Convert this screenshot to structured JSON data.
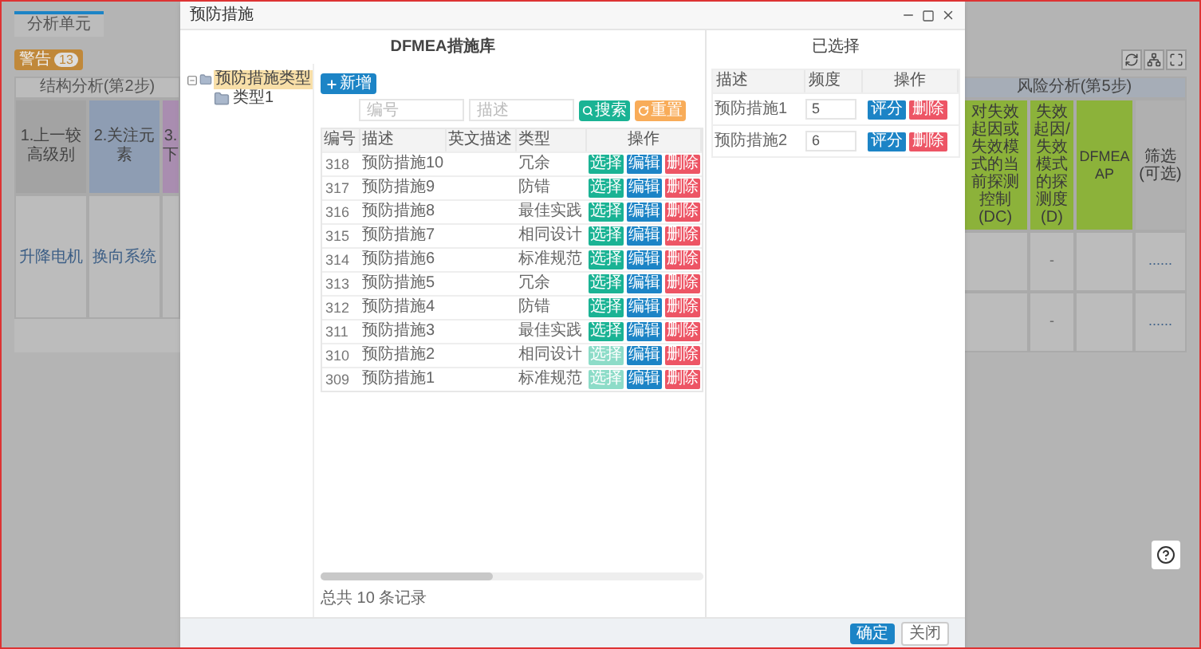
{
  "background": {
    "tabs": [
      {
        "label": "分析单元",
        "selected": true
      }
    ],
    "badge": {
      "label": "警告",
      "count": "13"
    },
    "left_table": {
      "group": "结构分析(第2步)",
      "columns": [
        {
          "label": "1.上一较高级别",
          "color": "#a3a3a3"
        },
        {
          "label": "2.关注元素",
          "color": "#8e9db3"
        },
        {
          "label": "3.下",
          "color": "#a98db0"
        }
      ],
      "rows": [
        [
          "升降电机",
          "换向系统"
        ]
      ]
    },
    "right_table": {
      "group": "风险分析(第5步)",
      "columns": [
        {
          "label": "对失效起因或失效模式的当前探测控制 (DC)",
          "color": "#8cb23a"
        },
        {
          "label": "失效起因/失效模式的探测度 (D)",
          "color": "#8cb23a"
        },
        {
          "label": "DFMEA AP",
          "color": "#8cb23a"
        },
        {
          "label": "筛选 (可选)",
          "color": "#b0b0b0"
        }
      ],
      "rows": [
        [
          "",
          "-",
          "",
          "......"
        ],
        [
          "",
          "-",
          "",
          "......"
        ]
      ]
    }
  },
  "dialog": {
    "title": "预防措施",
    "library_title": "DFMEA措施库",
    "selected_title": "已选择",
    "tree": [
      {
        "label": "预防措施类型",
        "selected": true,
        "expanded": true,
        "children": [
          {
            "label": "类型1",
            "selected": false
          }
        ]
      }
    ],
    "add_button": "新增",
    "filters": [
      {
        "placeholder": "编号"
      },
      {
        "placeholder": "描述"
      }
    ],
    "search_button": "搜索",
    "reset_button": "重置",
    "table": {
      "columns": [
        "编号",
        "描述",
        "英文描述",
        "类型",
        "操作"
      ],
      "rows": [
        {
          "id": "318",
          "description": "预防措施10",
          "type": "冗余",
          "actions": [
            "选择",
            "编辑",
            "删除"
          ],
          "disabled": false
        },
        {
          "id": "317",
          "description": "预防措施9",
          "type": "防错",
          "actions": [
            "选择",
            "编辑",
            "删除"
          ],
          "disabled": false
        },
        {
          "id": "316",
          "description": "预防措施8",
          "type": "最佳实践",
          "actions": [
            "选择",
            "编辑",
            "删除"
          ],
          "disabled": false
        },
        {
          "id": "315",
          "description": "预防措施7",
          "type": "相同设计",
          "actions": [
            "选择",
            "编辑",
            "删除"
          ],
          "disabled": false
        },
        {
          "id": "314",
          "description": "预防措施6",
          "type": "标准规范",
          "actions": [
            "选择",
            "编辑",
            "删除"
          ],
          "disabled": false
        },
        {
          "id": "313",
          "description": "预防措施5",
          "type": "冗余",
          "actions": [
            "选择",
            "编辑",
            "删除"
          ],
          "disabled": false
        },
        {
          "id": "312",
          "description": "预防措施4",
          "type": "防错",
          "actions": [
            "选择",
            "编辑",
            "删除"
          ],
          "disabled": false
        },
        {
          "id": "311",
          "description": "预防措施3",
          "type": "最佳实践",
          "actions": [
            "选择",
            "编辑",
            "删除"
          ],
          "disabled": false
        },
        {
          "id": "310",
          "description": "预防措施2",
          "type": "相同设计",
          "actions": [
            "选择",
            "编辑",
            "删除"
          ],
          "disabled": true
        },
        {
          "id": "309",
          "description": "预防措施1",
          "type": "标准规范",
          "actions": [
            "选择",
            "编辑",
            "删除"
          ],
          "disabled": true
        }
      ]
    },
    "total": "总共 10 条记录",
    "selected_table": {
      "columns": [
        "描述",
        "频度",
        "操作"
      ],
      "rows": [
        {
          "description": "预防措施1",
          "frequency": "5",
          "actions": [
            "评分",
            "删除"
          ]
        },
        {
          "description": "预防措施2",
          "frequency": "6",
          "actions": [
            "评分",
            "删除"
          ]
        }
      ]
    },
    "footer": [
      {
        "label": "确定",
        "primary": true
      },
      {
        "label": "关闭",
        "primary": false
      }
    ]
  }
}
